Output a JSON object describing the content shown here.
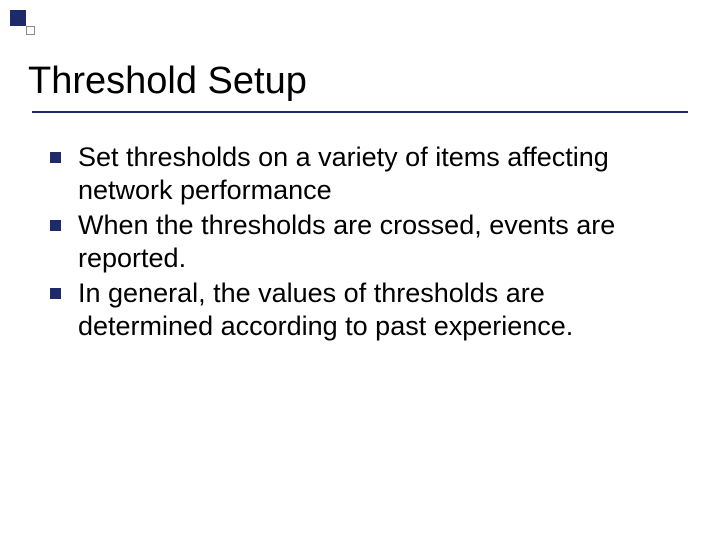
{
  "slide": {
    "title": "Threshold Setup",
    "bullets": [
      "Set thresholds on a variety of items affecting network performance",
      "When the thresholds are crossed, events are reported.",
      "In general, the values of thresholds are determined according to past experience."
    ]
  }
}
